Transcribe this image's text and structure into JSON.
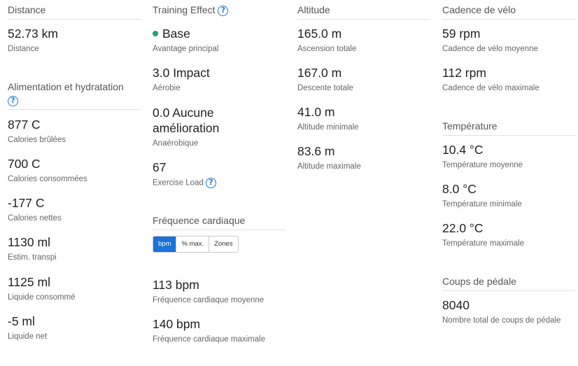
{
  "distance": {
    "header": "Distance",
    "value": "52.73 km",
    "label": "Distance"
  },
  "nutrition": {
    "header": "Alimentation et hydratation",
    "metrics": [
      {
        "value": "877 C",
        "label": "Calories brûlées"
      },
      {
        "value": "700 C",
        "label": "Calories consommées"
      },
      {
        "value": "-177 C",
        "label": "Calories nettes"
      },
      {
        "value": "1130 ml",
        "label": "Estim. transpi"
      },
      {
        "value": "1125 ml",
        "label": "Liquide consommé"
      },
      {
        "value": "-5 ml",
        "label": "Liquide net"
      }
    ]
  },
  "training_effect": {
    "header": "Training Effect",
    "primary_value": "Base",
    "primary_label": "Avantage principal",
    "primary_dot_color": "#17a673",
    "aerobic_value": "3.0 Impact",
    "aerobic_label": "Aérobie",
    "anaerobic_value_line1": "0.0 Aucune",
    "anaerobic_value_line2": "amélioration",
    "anaerobic_label": "Anaérobique",
    "load_value": "67",
    "load_label": "Exercise Load"
  },
  "heart_rate": {
    "header": "Fréquence cardiaque",
    "tabs": [
      {
        "label": "bpm",
        "active": true
      },
      {
        "label": "% max.",
        "active": false
      },
      {
        "label": "Zones",
        "active": false
      }
    ],
    "avg_value": "113 bpm",
    "avg_label": "Fréquence cardiaque moyenne",
    "max_value": "140 bpm",
    "max_label": "Fréquence cardiaque maximale"
  },
  "altitude": {
    "header": "Altitude",
    "metrics": [
      {
        "value": "165.0 m",
        "label": "Ascension totale"
      },
      {
        "value": "167.0 m",
        "label": "Descente totale"
      },
      {
        "value": "41.0 m",
        "label": "Altitude minimale"
      },
      {
        "value": "83.6 m",
        "label": "Altitude maximale"
      }
    ]
  },
  "cadence": {
    "header": "Cadence de vélo",
    "metrics": [
      {
        "value": "59 rpm",
        "label": "Cadence de vélo moyenne"
      },
      {
        "value": "112 rpm",
        "label": "Cadence de vélo maximale"
      }
    ]
  },
  "temperature": {
    "header": "Température",
    "metrics": [
      {
        "value": "10.4 °C",
        "label": "Température moyenne"
      },
      {
        "value": "8.0 °C",
        "label": "Température minimale"
      },
      {
        "value": "22.0 °C",
        "label": "Température maximale"
      }
    ]
  },
  "pedal_strokes": {
    "header": "Coups de pédale",
    "value": "8040",
    "label": "Nombre total de coups de pédale"
  },
  "icons": {
    "help": "?"
  },
  "colors": {
    "accent": "#1a73d9",
    "primary_dot": "#17a673"
  }
}
